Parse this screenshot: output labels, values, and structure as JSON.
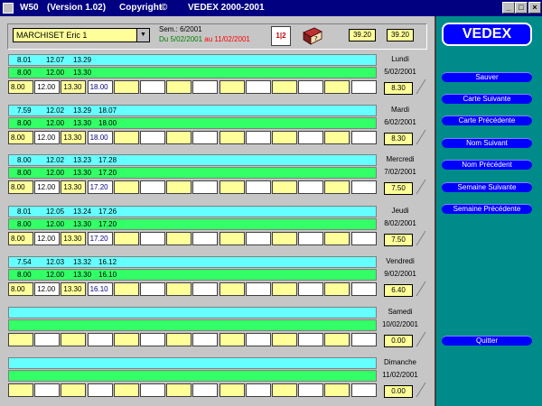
{
  "window": {
    "title": "W50",
    "version": "(Version 1.02)",
    "copyright": "Copyright",
    "copyright_symbol": "©",
    "company": "VEDEX 2000-2001"
  },
  "employee": {
    "selected": "MARCHISET Eric 1"
  },
  "week": {
    "sem": "Sem.: 6/2001",
    "du": "Du 5/02/2001",
    "au": "au 11/02/2001"
  },
  "totals": {
    "total1": "39.20",
    "total2": "39.20"
  },
  "days": [
    {
      "name": "Lundi",
      "date": "5/02/2001",
      "total": "8.30",
      "pointages": [
        "8.01",
        "12.07",
        "13.29",
        ""
      ],
      "theoretical": [
        "8.00",
        "12.00",
        "13.30",
        ""
      ],
      "entries": [
        "8.00",
        "12.00",
        "13.30",
        "18.00"
      ]
    },
    {
      "name": "Mardi",
      "date": "6/02/2001",
      "total": "8.30",
      "pointages": [
        "7.59",
        "12.02",
        "13.29",
        "18.07"
      ],
      "theoretical": [
        "8.00",
        "12.00",
        "13.30",
        "18.00"
      ],
      "entries": [
        "8.00",
        "12.00",
        "13.30",
        "18.00"
      ]
    },
    {
      "name": "Mercredi",
      "date": "7/02/2001",
      "total": "7.50",
      "pointages": [
        "8.00",
        "12.02",
        "13.23",
        "17.28"
      ],
      "theoretical": [
        "8.00",
        "12.00",
        "13.30",
        "17.20"
      ],
      "entries": [
        "8.00",
        "12.00",
        "13.30",
        "17.20"
      ]
    },
    {
      "name": "Jeudi",
      "date": "8/02/2001",
      "total": "7.50",
      "pointages": [
        "8.01",
        "12.05",
        "13.24",
        "17.26"
      ],
      "theoretical": [
        "8.00",
        "12.00",
        "13.30",
        "17.20"
      ],
      "entries": [
        "8.00",
        "12.00",
        "13.30",
        "17.20"
      ]
    },
    {
      "name": "Vendredi",
      "date": "9/02/2001",
      "total": "6.40",
      "pointages": [
        "7.54",
        "12.03",
        "13.32",
        "16.12"
      ],
      "theoretical": [
        "8.00",
        "12.00",
        "13.30",
        "16.10"
      ],
      "entries": [
        "8.00",
        "12.00",
        "13.30",
        "16.10"
      ]
    },
    {
      "name": "Samedi",
      "date": "10/02/2001",
      "total": "0.00",
      "pointages": [
        "",
        "",
        "",
        ""
      ],
      "theoretical": [
        "",
        "",
        "",
        ""
      ],
      "entries": [
        "",
        "",
        "",
        ""
      ]
    },
    {
      "name": "Dimanche",
      "date": "11/02/2001",
      "total": "0.00",
      "pointages": [
        "",
        "",
        "",
        ""
      ],
      "theoretical": [
        "",
        "",
        "",
        ""
      ],
      "entries": [
        "",
        "",
        "",
        ""
      ]
    }
  ],
  "sidebar": {
    "brand": "VEDEX",
    "buttons": [
      "Sauver",
      "Carte Suivante",
      "Carte Précédente",
      "Nom Suivant",
      "Nom Précédent",
      "Semaine Suivante",
      "Semaine Précédente"
    ],
    "quit": "Quitter"
  },
  "colors": {
    "title_bar": "#000080",
    "sidebar": "#008b8b",
    "button": "#0000ff",
    "cyan_row": "#66ffff",
    "green_row": "#33ff66",
    "input_yellow": "#ffff99"
  }
}
